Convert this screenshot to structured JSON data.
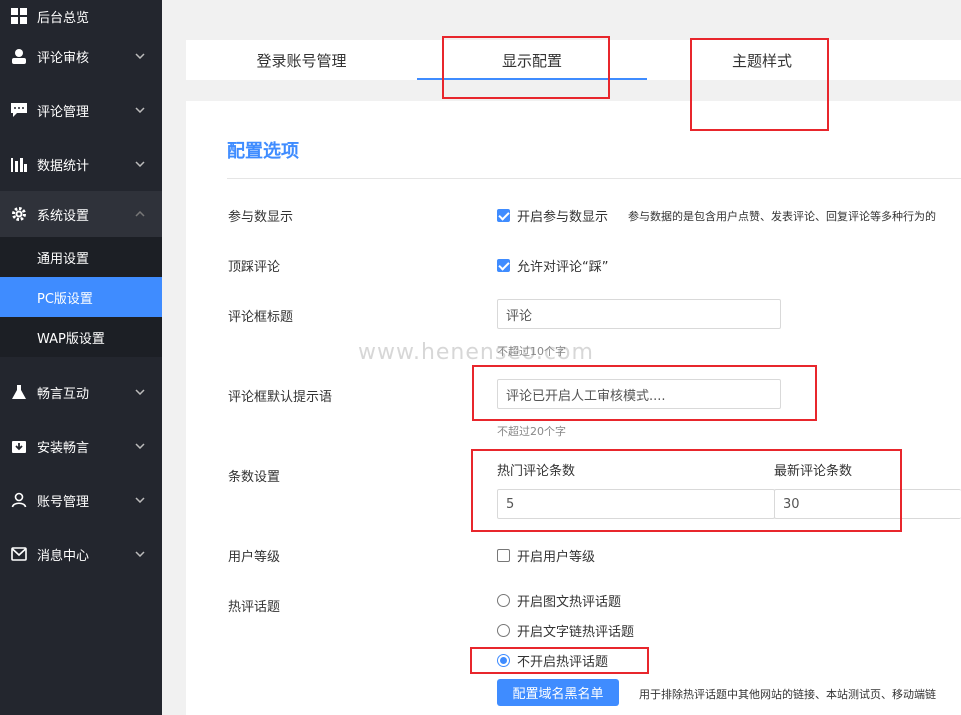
{
  "sidebar": {
    "items": [
      {
        "label": "后台总览",
        "icon": "dashboard-icon"
      },
      {
        "label": "评论审核",
        "icon": "user-icon"
      },
      {
        "label": "评论管理",
        "icon": "comment-icon"
      },
      {
        "label": "数据统计",
        "icon": "bar-chart-icon"
      },
      {
        "label": "系统设置",
        "icon": "gear-icon"
      },
      {
        "label": "畅言互动",
        "icon": "flask-icon"
      },
      {
        "label": "安装畅言",
        "icon": "download-icon"
      },
      {
        "label": "账号管理",
        "icon": "person-icon"
      },
      {
        "label": "消息中心",
        "icon": "mail-icon"
      }
    ],
    "sub_items": [
      {
        "label": "通用设置"
      },
      {
        "label": "PC版设置"
      },
      {
        "label": "WAP版设置"
      }
    ]
  },
  "tabs": [
    {
      "label": "登录账号管理"
    },
    {
      "label": "显示配置"
    },
    {
      "label": "主题样式"
    }
  ],
  "main": {
    "section_title": "配置选项",
    "participants": {
      "label": "参与数显示",
      "option": "开启参与数显示",
      "checked": true,
      "description": "参与数据的是包含用户点赞、发表评论、回复评论等多种行为的"
    },
    "dislike": {
      "label": "顶踩评论",
      "option": "允许对评论“踩”",
      "checked": true
    },
    "box_title": {
      "label": "评论框标题",
      "value": "评论",
      "hint": "不超过10个字"
    },
    "box_placeholder": {
      "label": "评论框默认提示语",
      "value": "评论已开启人工审核模式....",
      "hint": "不超过20个字"
    },
    "counts": {
      "label": "条数设置",
      "hot_label": "热门评论条数",
      "hot_value": "5",
      "new_label": "最新评论条数",
      "new_value": "30"
    },
    "user_level": {
      "label": "用户等级",
      "option": "开启用户等级",
      "checked": false
    },
    "hot_topics": {
      "label": "热评话题",
      "options": [
        "开启图文热评话题",
        "开启文字链热评话题",
        "不开启热评话题"
      ],
      "selected_index": 2,
      "button": "配置域名黑名单",
      "button_desc": "用于排除热评话题中其他网站的链接、本站测试页、移动端链"
    }
  },
  "watermark": "www.henenseo.com",
  "colors": {
    "accent": "#3f8cff",
    "sidebar_bg": "#23262e",
    "annotation_red": "#e8262c"
  }
}
